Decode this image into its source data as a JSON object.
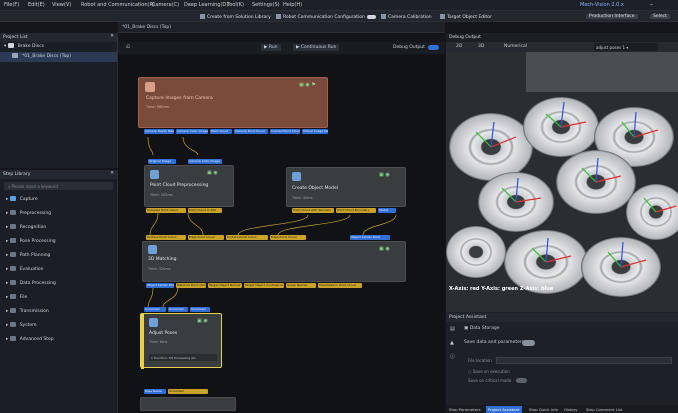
{
  "menu": [
    "File(F)",
    "Edit(E)",
    "View(V)",
    "Robot and Communication(R)",
    "Camera(C)",
    "Deep Learning(D)",
    "Tool(K)",
    "Settings(S)",
    "Help(H)"
  ],
  "title": {
    "app": "Mech-Vision 2.0.x",
    "right1": "Production Interface",
    "right2": "Select"
  },
  "toolbar": [
    "Create from Solution Library",
    "Robot Communication Configuration",
    "Camera Calibration",
    "Target Object Editor"
  ],
  "project_list": {
    "title": "Project List",
    "items": [
      "Brake Discs",
      "*01_Brake Discs (Top)"
    ]
  },
  "step_library": {
    "title": "Step Library",
    "search": "Please input a keyword",
    "items": [
      "Capture",
      "Preprocessing",
      "Recognition",
      "Pose Processing",
      "Path Planning",
      "Evaluation",
      "Data Processing",
      "File",
      "Transmission",
      "System",
      "Advanced Step"
    ]
  },
  "canvas": {
    "tab": "*01_Brake Discs (Top)",
    "buttons": [
      "Run",
      "Continuous Run"
    ],
    "debug": "Debug Output",
    "nodes": {
      "capture": {
        "title": "Capture Images from Camera",
        "sub": "Time: 580ms",
        "ports": [
          "Camera Depth Map",
          "Camera Color Image",
          "Point Cloud",
          "Camera Point Cloud",
          "Colored Point Cloud",
          "Virtual Image Data"
        ]
      },
      "pcp": {
        "title": "Point Cloud Preprocessing",
        "sub": "Time: 102ms",
        "in": [
          "Original Image",
          "Camera Color Image"
        ],
        "out": [
          "Sampled Point Cloud",
          "Point Cloud In ROI"
        ]
      },
      "com": {
        "title": "Create Object Model",
        "sub": "Time: 45ms",
        "ports": [
          "Point Cloud with Normals",
          "Point Cloud Boundary",
          "Model"
        ]
      },
      "match": {
        "title": "3D Matching",
        "sub": "Time: 320ms",
        "in": [
          "Surface Point Cloud",
          "Edge Point Cloud",
          "Surface Point Cloud",
          "Edge Point Cloud",
          "Object Center Point"
        ],
        "out": [
          "Object Center Points",
          "Matched Point Clouds",
          "Target Object Names",
          "Target Object Confidence",
          "Grasp Names",
          "Visualization Point Cloud"
        ]
      },
      "adjust": {
        "title": "Adjust Poses",
        "sub": "Time: 6ms",
        "note": "1 Function: Tilt Processing etc.",
        "ports": [
          "Unnamed",
          "Unnamed",
          "Unnamed",
          "Pose Name",
          "Unnamed"
        ]
      }
    }
  },
  "viewer": {
    "title": "Debug Output",
    "tabs": [
      "2D",
      "3D",
      "Numerical"
    ],
    "select": "adjust poses 1",
    "axis_text": "X-Axis: red  Y-Axis: green  Z-Axis: blue"
  },
  "assistant": {
    "title": "Project Assistant",
    "section": "Data Storage",
    "save": "Save data and parameters",
    "path_label": "File location",
    "opt1": "Save on execution",
    "opt2": "Save on critical mode"
  },
  "bottom_tabs": [
    "Step Parameters",
    "Project Assistant",
    "Step Quick Info",
    "History",
    "Step Comment List"
  ],
  "colors": {
    "accent": "#2f6fd6",
    "port_yellow": "#c9a227",
    "node": "#3a3d40"
  }
}
